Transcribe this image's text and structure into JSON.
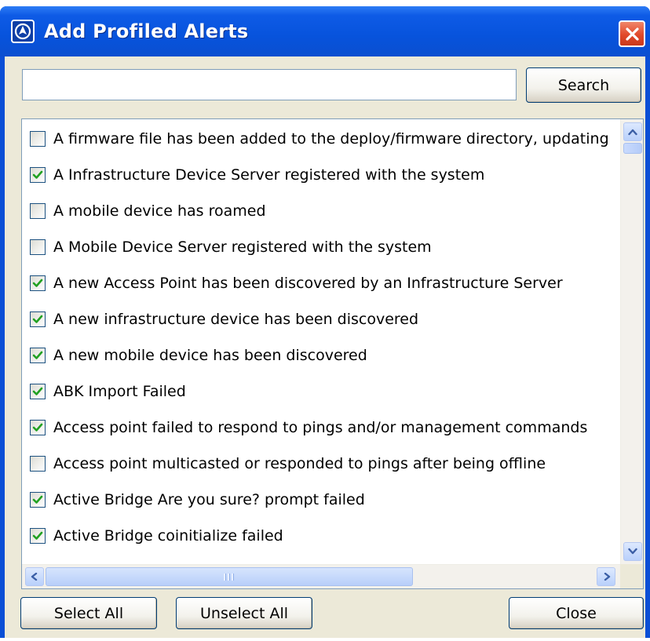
{
  "window": {
    "title": "Add Profiled Alerts"
  },
  "search": {
    "value": "",
    "placeholder": "",
    "button_label": "Search"
  },
  "alerts": [
    {
      "label": "A firmware file has been added to the deploy/firmware directory, updating",
      "checked": false
    },
    {
      "label": "A Infrastructure Device Server registered with the system",
      "checked": true
    },
    {
      "label": "A mobile device has roamed",
      "checked": false
    },
    {
      "label": "A Mobile Device Server registered with the system",
      "checked": false
    },
    {
      "label": "A new Access Point has been discovered by an Infrastructure Server",
      "checked": true
    },
    {
      "label": "A new infrastructure device has been discovered",
      "checked": true
    },
    {
      "label": "A new mobile device has been discovered",
      "checked": true
    },
    {
      "label": "ABK Import Failed",
      "checked": true
    },
    {
      "label": "Access point failed to respond to pings and/or management commands",
      "checked": true
    },
    {
      "label": "Access point multicasted or responded to pings after being offline",
      "checked": false
    },
    {
      "label": "Active Bridge Are you sure? prompt failed",
      "checked": true
    },
    {
      "label": "Active Bridge coinitialize failed",
      "checked": true
    }
  ],
  "footer": {
    "select_all_label": "Select All",
    "unselect_all_label": "Unselect All",
    "close_label": "Close"
  },
  "colors": {
    "titlebar": "#0a4fd6",
    "close_button": "#e1492a",
    "dialog_background": "#ece9d8",
    "check_mark": "#21a121"
  }
}
